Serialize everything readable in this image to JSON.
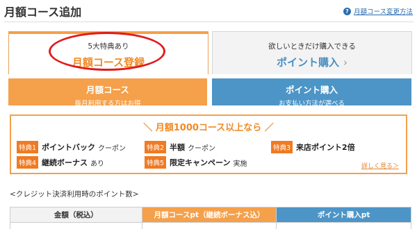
{
  "header": {
    "title": "月額コース追加",
    "help_link": "月額コース変更方法"
  },
  "tabs": {
    "monthly": {
      "sub": "5大特典あり",
      "main": "月額コース登録"
    },
    "points": {
      "sub": "欲しいときだけ購入できる",
      "main": "ポイント購入",
      "chevron": "›"
    }
  },
  "panels": {
    "monthly": {
      "title": "月額コース",
      "sub": "毎月利用する方はお得"
    },
    "points": {
      "title": "ポイント購入",
      "sub": "お支払い方法が選べる"
    }
  },
  "benefits": {
    "heading": "＼ 月額1000コース以上なら ／",
    "items": [
      {
        "badge": "特典1",
        "name": "ポイントバック",
        "note": "クーポン"
      },
      {
        "badge": "特典2",
        "name": "半額",
        "note": "クーポン"
      },
      {
        "badge": "特典3",
        "name": "来店ポイント2倍",
        "note": ""
      },
      {
        "badge": "特典4",
        "name": "継続ボーナス",
        "note": "あり"
      },
      {
        "badge": "特典5",
        "name": "限定キャンペーン",
        "note": "実施"
      }
    ],
    "details_link": "詳しく見る＞"
  },
  "note": "<クレジット決済利用時のポイント数>",
  "table": {
    "headers": [
      "金額（税込）",
      "月額コースpt（継続ボーナス込）",
      "ポイント購入pt"
    ]
  },
  "colors": {
    "orange": "#f5a04a",
    "blue": "#4d95c7",
    "badge": "#f07a22",
    "highlight_ring": "#e11b1b"
  }
}
